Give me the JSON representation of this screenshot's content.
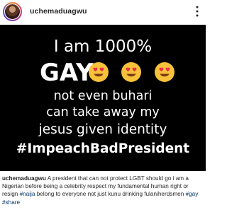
{
  "header": {
    "username": "uchemaduagwu",
    "avatar_icon": "profile-photo",
    "more_icon": "more-vertical-icon"
  },
  "post_image": {
    "line1": "I am 1000%",
    "line2": "GAY",
    "emoji": "heart-eyes-emoji",
    "line3": "not even buhari",
    "line4": "can take away my",
    "line5": "jesus given identity",
    "line6": "#ImpeachBadPresident"
  },
  "caption": {
    "username": "uchemaduagwu",
    "text1": " A president that can not protect LGBT should go i am a Nigerian before being a celebrity respect my fundamental human right or resign ",
    "tag1": "#naija",
    "text2": " belong to everyone not just kunu drinking fulaniherdsmen ",
    "tag2": "#gay",
    "text3": " ",
    "tag3": "#share"
  },
  "colors": {
    "background": "#ffffff",
    "image_background": "#000000",
    "hashtag": "#003569",
    "text": "#262626"
  }
}
